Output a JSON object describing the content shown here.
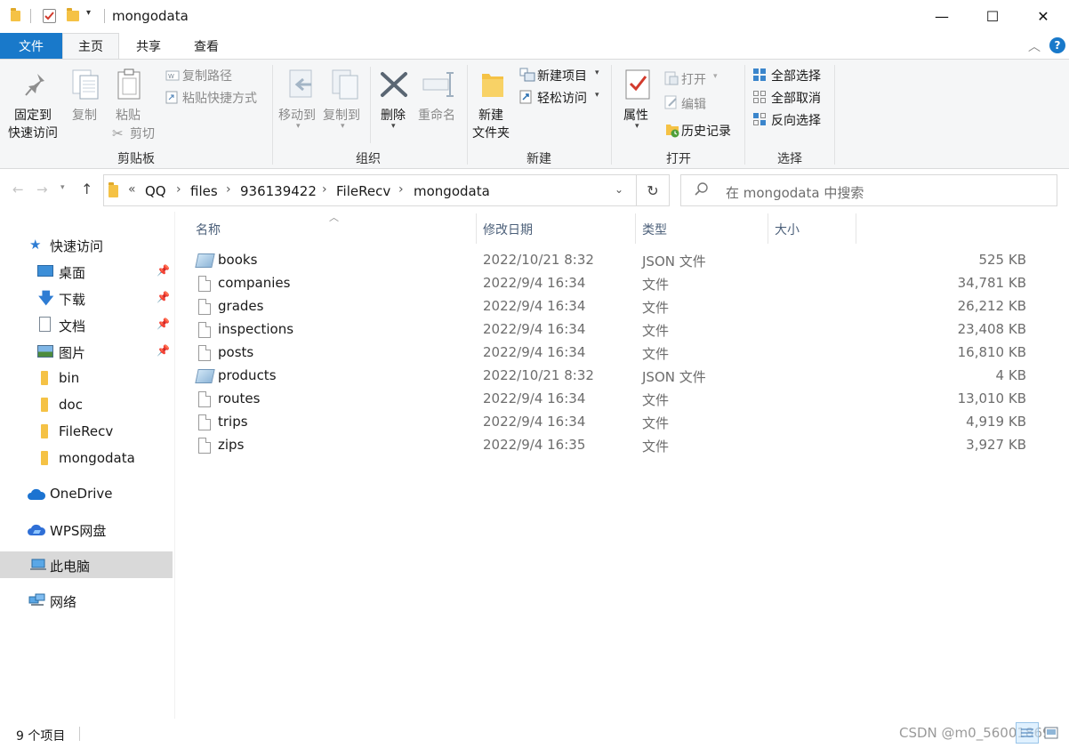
{
  "window": {
    "title": "mongodata",
    "controls": {
      "minimize": "—",
      "maximize": "☐",
      "close": "✕"
    }
  },
  "ribbon_tabs": [
    {
      "label": "文件"
    },
    {
      "label": "主页"
    },
    {
      "label": "共享"
    },
    {
      "label": "查看"
    }
  ],
  "ribbon": {
    "clipboard": {
      "label": "剪贴板",
      "pin": "固定到\n快速访问",
      "pin_l1": "固定到",
      "pin_l2": "快速访问",
      "copy": "复制",
      "paste": "粘贴",
      "copy_path": "复制路径",
      "paste_shortcut": "粘贴快捷方式",
      "cut": "剪切"
    },
    "organize": {
      "label": "组织",
      "move_to": "移动到",
      "copy_to": "复制到",
      "delete": "删除",
      "rename": "重命名"
    },
    "new": {
      "label": "新建",
      "new_folder_l1": "新建",
      "new_folder_l2": "文件夹",
      "new_item": "新建项目",
      "easy_access": "轻松访问"
    },
    "open": {
      "label": "打开",
      "properties": "属性",
      "open": "打开",
      "edit": "编辑",
      "history": "历史记录"
    },
    "select": {
      "label": "选择",
      "select_all": "全部选择",
      "select_none": "全部取消",
      "invert": "反向选择"
    }
  },
  "navigation": {
    "breadcrumb": [
      "«",
      "QQ",
      "files",
      "936139422",
      "FileRecv",
      "mongodata"
    ],
    "search_placeholder": "在 mongodata 中搜索"
  },
  "sidebar": {
    "quick_access": "快速访问",
    "items": [
      {
        "label": "桌面",
        "pinned": true
      },
      {
        "label": "下载",
        "pinned": true
      },
      {
        "label": "文档",
        "pinned": true
      },
      {
        "label": "图片",
        "pinned": true
      },
      {
        "label": "bin",
        "pinned": false
      },
      {
        "label": "doc",
        "pinned": false
      },
      {
        "label": "FileRecv",
        "pinned": false
      },
      {
        "label": "mongodata",
        "pinned": false
      }
    ],
    "onedrive": "OneDrive",
    "wps": "WPS网盘",
    "this_pc": "此电脑",
    "network": "网络"
  },
  "file_list": {
    "columns": {
      "name": "名称",
      "date": "修改日期",
      "type": "类型",
      "size": "大小"
    },
    "rows": [
      {
        "name": "books",
        "date": "2022/10/21 8:32",
        "type": "JSON 文件",
        "size": "525 KB",
        "icon": "json-file-icon"
      },
      {
        "name": "companies",
        "date": "2022/9/4 16:34",
        "type": "文件",
        "size": "34,781 KB",
        "icon": "file-icon"
      },
      {
        "name": "grades",
        "date": "2022/9/4 16:34",
        "type": "文件",
        "size": "26,212 KB",
        "icon": "file-icon"
      },
      {
        "name": "inspections",
        "date": "2022/9/4 16:34",
        "type": "文件",
        "size": "23,408 KB",
        "icon": "file-icon"
      },
      {
        "name": "posts",
        "date": "2022/9/4 16:34",
        "type": "文件",
        "size": "16,810 KB",
        "icon": "file-icon"
      },
      {
        "name": "products",
        "date": "2022/10/21 8:32",
        "type": "JSON 文件",
        "size": "4 KB",
        "icon": "json-file-icon"
      },
      {
        "name": "routes",
        "date": "2022/9/4 16:34",
        "type": "文件",
        "size": "13,010 KB",
        "icon": "file-icon"
      },
      {
        "name": "trips",
        "date": "2022/9/4 16:34",
        "type": "文件",
        "size": "4,919 KB",
        "icon": "file-icon"
      },
      {
        "name": "zips",
        "date": "2022/9/4 16:35",
        "type": "文件",
        "size": "3,927 KB",
        "icon": "file-icon"
      }
    ]
  },
  "status": {
    "item_count": "9 个项目",
    "watermark": "CSDN @m0_56001869"
  },
  "colors": {
    "accent": "#1979ca",
    "folder": "#f5c245",
    "selected_bg": "#d9d9d9"
  }
}
